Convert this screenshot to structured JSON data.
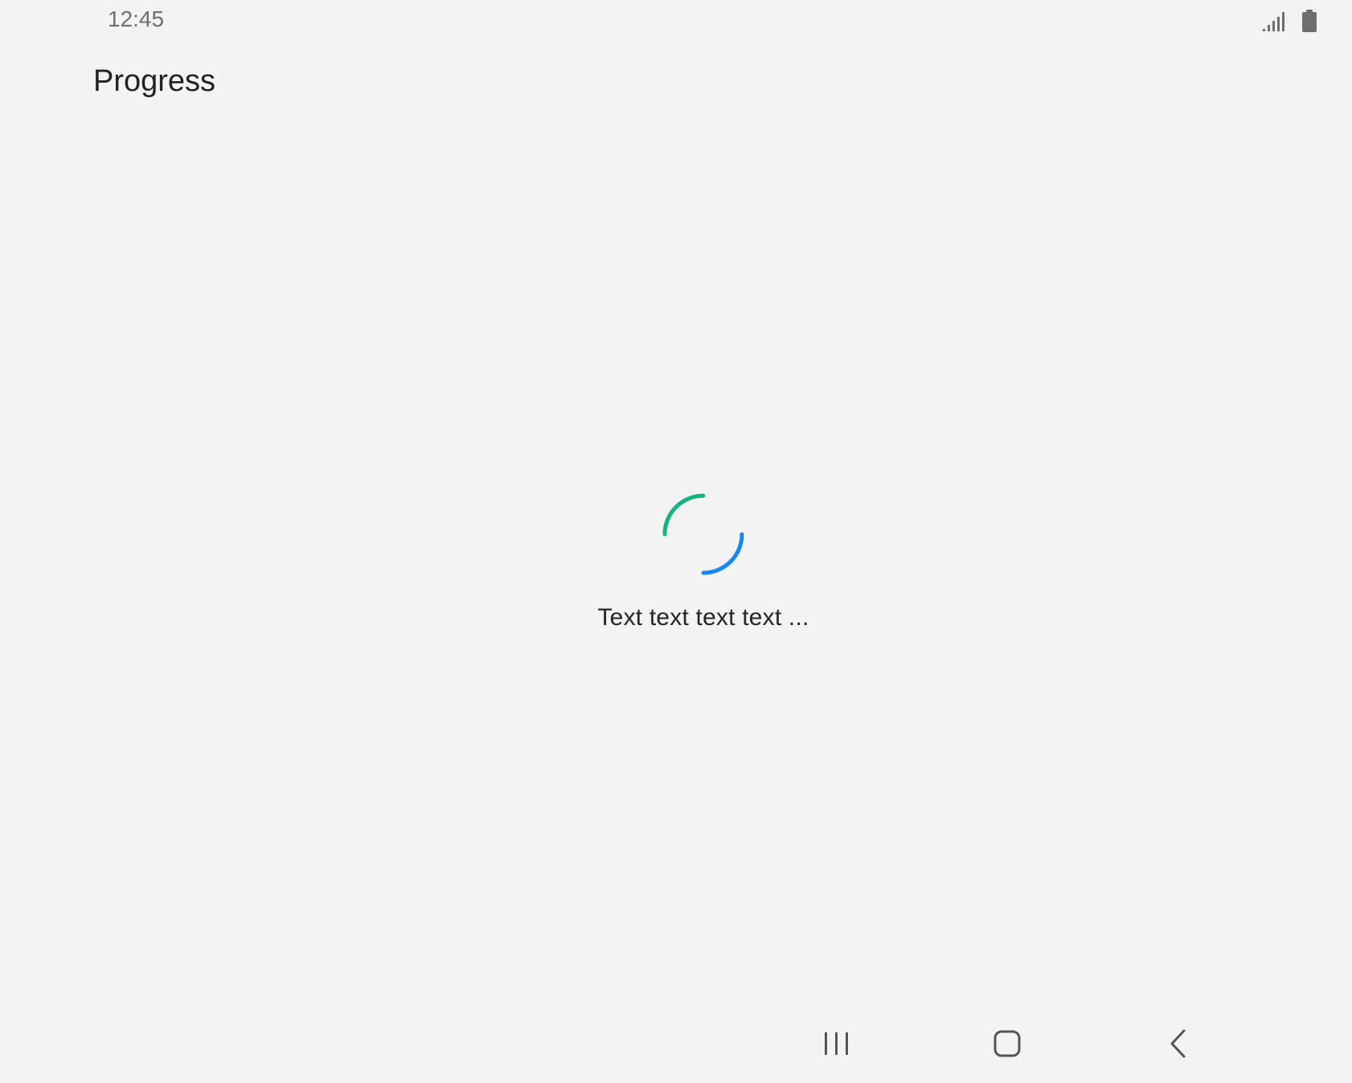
{
  "status_bar": {
    "time": "12:45",
    "icons": [
      "signal-icon",
      "battery-icon"
    ],
    "icon_color": "#6e6e6e"
  },
  "app_bar": {
    "title": "Progress"
  },
  "progress": {
    "message": "Text text text text ...",
    "spinner_colors": [
      "#13b383",
      "#1a87f0"
    ]
  },
  "nav_bar": {
    "buttons": [
      "recents-icon",
      "home-icon",
      "back-icon"
    ]
  },
  "colors": {
    "background": "#f3f3f3",
    "text": "#222222"
  }
}
